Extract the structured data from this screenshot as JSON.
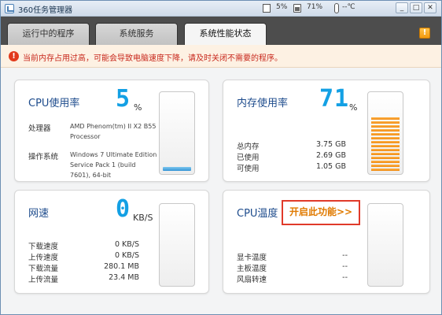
{
  "window": {
    "title": "360任务管理器",
    "cpu_status": "5%",
    "mem_status": "71%",
    "temp_status": "--℃",
    "min_label": "_",
    "max_label": "□",
    "close_label": "✕"
  },
  "tabs": [
    {
      "label": "运行中的程序"
    },
    {
      "label": "系统服务"
    },
    {
      "label": "系统性能状态"
    }
  ],
  "help_label": "!",
  "warning": {
    "icon": "!",
    "text": "当前内存占用过高，可能会导致电脑速度下降，请及时关闭不需要的程序。"
  },
  "cpu": {
    "title": "CPU使用率",
    "value": "5",
    "unit": "%",
    "usage_fraction": 0.05,
    "processor_label": "处理器",
    "processor_value": "AMD Phenom(tm) II X2 B55 Processor",
    "os_label": "操作系统",
    "os_value": "Windows 7 Ultimate Edition Service Pack 1 (build 7601), 64-bit"
  },
  "memory": {
    "title": "内存使用率",
    "value": "71",
    "unit": "%",
    "usage_fraction": 0.71,
    "rows": [
      {
        "label": "总内存",
        "value": "3.75 GB"
      },
      {
        "label": "已使用",
        "value": "2.69 GB"
      },
      {
        "label": "可使用",
        "value": "1.05 GB"
      }
    ]
  },
  "network": {
    "title": "网速",
    "value": "0",
    "unit": "KB/S",
    "rows": [
      {
        "label": "下载速度",
        "value": "0 KB/S"
      },
      {
        "label": "上传速度",
        "value": "0 KB/S"
      },
      {
        "label": "下载流量",
        "value": "280.1 MB"
      },
      {
        "label": "上传流量",
        "value": "23.4 MB"
      }
    ]
  },
  "temperature": {
    "title": "CPU温度",
    "enable_link": "开启此功能>>",
    "rows": [
      {
        "label": "显卡温度",
        "value": "--"
      },
      {
        "label": "主板温度",
        "value": "--"
      },
      {
        "label": "风扇转速",
        "value": "--"
      }
    ]
  }
}
